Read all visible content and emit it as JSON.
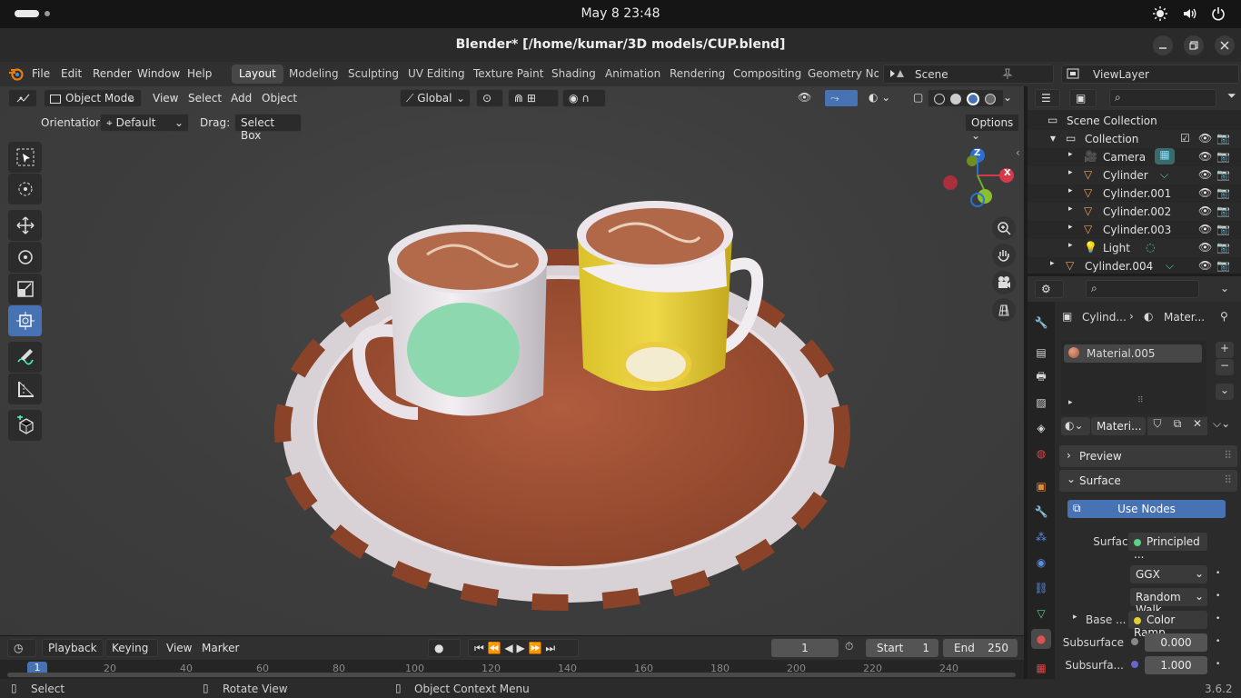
{
  "system": {
    "clock": "May 8  23:48"
  },
  "window": {
    "title": "Blender* [/home/kumar/3D models/CUP.blend]"
  },
  "menu": {
    "items": [
      "File",
      "Edit",
      "Render",
      "Window",
      "Help"
    ]
  },
  "workspaces": {
    "tabs": [
      "Layout",
      "Modeling",
      "Sculpting",
      "UV Editing",
      "Texture Paint",
      "Shading",
      "Animation",
      "Rendering",
      "Compositing",
      "Geometry Noc"
    ],
    "active": "Layout"
  },
  "scene": {
    "scene_name": "Scene",
    "view_layer": "ViewLayer"
  },
  "viewport_header": {
    "mode": "Object Mode",
    "menus": [
      "View",
      "Select",
      "Add",
      "Object"
    ],
    "transform_orientation": "Global",
    "options_label": "Options"
  },
  "tool_settings": {
    "orientation_label": "Orientation:",
    "orientation_value": "Default",
    "drag_label": "Drag:",
    "drag_value": "Select Box"
  },
  "gizmo": {
    "z": "Z",
    "x": "X"
  },
  "timeline": {
    "menus": [
      "Playback",
      "Keying",
      "View",
      "Marker"
    ],
    "current_frame": "1",
    "start_label": "Start",
    "start_value": "1",
    "end_label": "End",
    "end_value": "250",
    "ruler": [
      "1",
      "20",
      "40",
      "60",
      "80",
      "100",
      "120",
      "140",
      "160",
      "180",
      "200",
      "220",
      "240"
    ]
  },
  "status": {
    "select": "Select",
    "rotate": "Rotate View",
    "context": "Object Context Menu",
    "version": "3.6.2"
  },
  "outliner": {
    "root": "Scene Collection",
    "collection": "Collection",
    "items": [
      "Camera",
      "Cylinder",
      "Cylinder.001",
      "Cylinder.002",
      "Cylinder.003",
      "Light"
    ],
    "extra": "Cylinder.004"
  },
  "properties": {
    "breadcrumb_object": "Cylind...",
    "breadcrumb_material": "Mater...",
    "material_slot": "Material.005",
    "material_name": "Materi...",
    "panel_preview": "Preview",
    "panel_surface": "Surface",
    "use_nodes": "Use Nodes",
    "surface_label": "Surface",
    "surface_value": "Principled ...",
    "distribution": "GGX",
    "subsurface_method": "Random Walk",
    "base_color_label": "Base ...",
    "base_color_value": "Color Ramp",
    "subsurface_label": "Subsurface",
    "subsurface_value": "0.000",
    "subsurface_radius_label": "Subsurfa...",
    "subsurface_radius_value": "1.000"
  },
  "colors": {
    "accent": "#4772b3",
    "tray": "#a5533a",
    "cup_green": "#8ed8b0",
    "cup_yellow": "#e0c230"
  }
}
